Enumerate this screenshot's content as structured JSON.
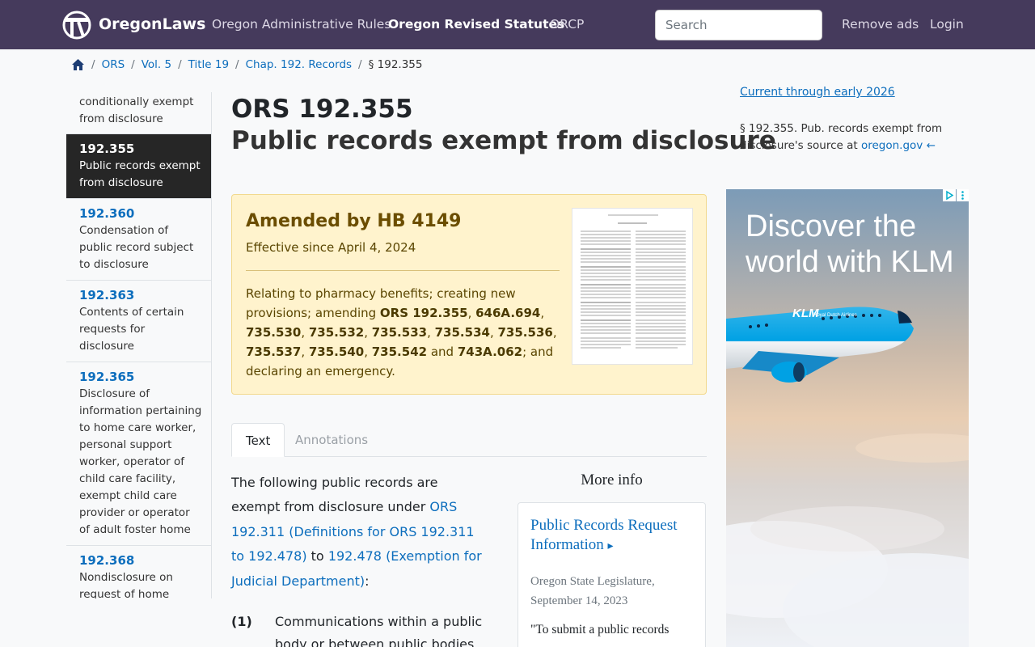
{
  "nav": {
    "brand": "OregonLaws",
    "links": [
      "Oregon Administrative Rules",
      "Oregon Revised Statutes",
      "ORCP"
    ],
    "search_placeholder": "Search",
    "remove_ads": "Remove ads",
    "login": "Login"
  },
  "breadcrumb": {
    "items": [
      "ORS",
      "Vol. 5",
      "Title 19",
      "Chap. 192. Records"
    ],
    "current": "§ 192.355"
  },
  "left_list": [
    {
      "num": "",
      "desc": "conditionally exempt from disclosure"
    },
    {
      "num": "192.355",
      "desc": "Public records exempt from disclosure"
    },
    {
      "num": "192.360",
      "desc": "Condensation of public record subject to disclosure"
    },
    {
      "num": "192.363",
      "desc": "Contents of certain requests for disclosure"
    },
    {
      "num": "192.365",
      "desc": "Disclosure of information pertaining to home care worker, personal support worker, operator of child care facility, exempt child care provider or operator of adult foster home"
    },
    {
      "num": "192.368",
      "desc": "Nondisclosure on request of home address, home"
    }
  ],
  "heading": {
    "number": "ORS 192.355",
    "title": "Public records exempt from disclosure"
  },
  "amend": {
    "prefix": "Amended by",
    "bill": "HB 4149",
    "effective": "Effective since April 4, 2024",
    "desc_lead": "Relating to pharmacy benefits; creating new provisions; amending",
    "statutes": [
      "ORS 192.355",
      "646A.694",
      "735.530",
      "735.532",
      "735.533",
      "735.534",
      "735.536",
      "735.537",
      "735.540",
      "735.542"
    ],
    "and_word": "and",
    "last_statute": "743A.062",
    "desc_tail": "; and declaring an emergency."
  },
  "tabs": {
    "text": "Text",
    "annotations": "Annotations"
  },
  "body": {
    "intro": "The following public records are exempt from disclosure under",
    "link1": "ORS 192.311 (Definitions for ORS 192.311 to 192.478)",
    "to": "to",
    "link2": "192.478 (Exemption for Judicial Department)",
    "end": ":",
    "sub1_label": "(1)",
    "sub1_text": "Communications within a public body or between public bodies of"
  },
  "more_info": {
    "heading": "More info",
    "card_title": "Public Records Request Information",
    "card_arrow": "▸",
    "card_source": "Oregon State Legislature, September 14, 2023",
    "card_quote": "\"To submit a public records"
  },
  "right": {
    "current": "Current through early 2026",
    "source_text": "§ 192.355. Pub. records exempt from disclosure's source at",
    "source_link": "oregon.gov",
    "source_arrow": "←"
  },
  "ad": {
    "headline": "Discover the world with KLM",
    "plane_label": "KLM",
    "plane_sub": "Royal Dutch Airlines",
    "colors": {
      "sky_top": "#7c9bb7",
      "sky_mid": "#e8cdb2",
      "cloud": "#eef1f6",
      "plane_blue": "#00a1e4"
    }
  }
}
